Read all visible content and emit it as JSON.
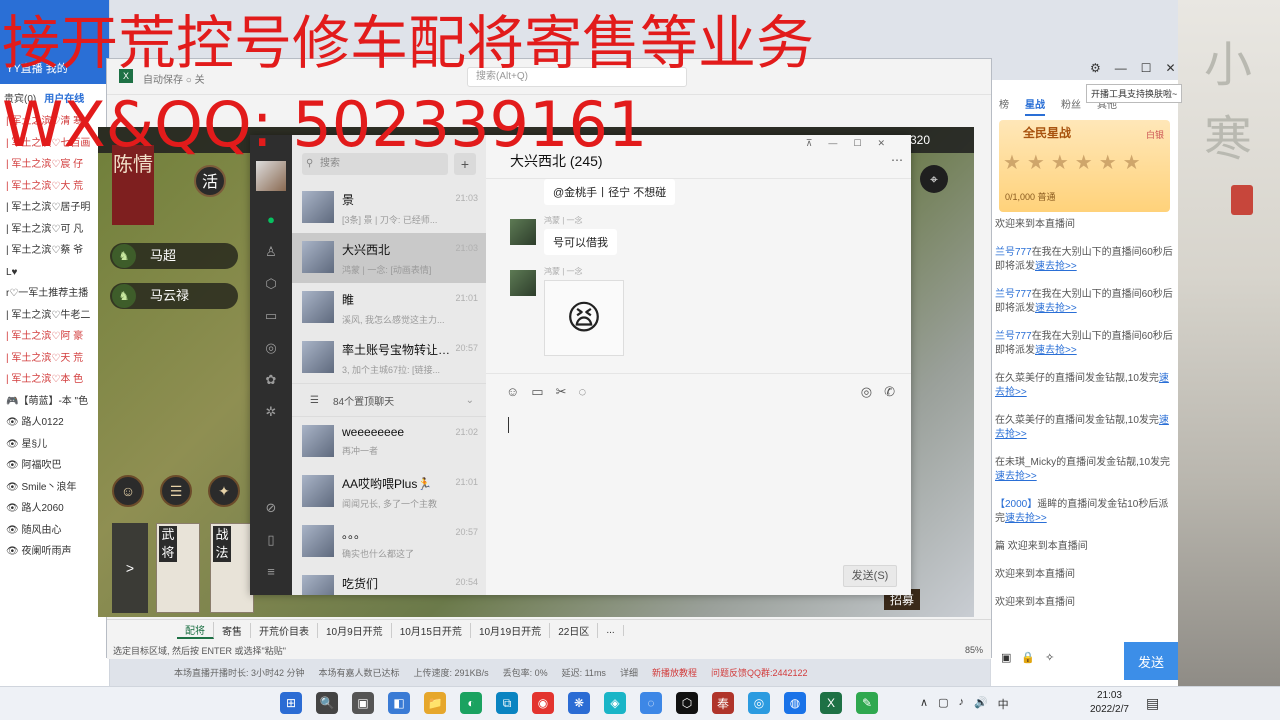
{
  "overlay": {
    "line1": "接开荒控号修车配将寄售等业务",
    "line2": "WX&QQ:   502339161"
  },
  "left_panel": {
    "header_text": "YY直播  我的",
    "tabs": [
      "贵宾(0)",
      "用户在线"
    ],
    "items": [
      {
        "text": "| 军土之滨♡清  寒",
        "red": true
      },
      {
        "text": "| 军土之滨♡七百画",
        "red": true
      },
      {
        "text": "| 军土之滨♡宸  仔",
        "red": true
      },
      {
        "text": "| 军土之滨♡大  荒",
        "red": true
      },
      {
        "text": "| 军土之滨♡居子明",
        "red": false
      },
      {
        "text": "| 军土之滨♡可  凡",
        "red": false
      },
      {
        "text": "| 军土之滨♡蔡  爷",
        "red": false
      },
      {
        "text": "L♥",
        "red": false
      },
      {
        "text": "r♡一军土推荐主播",
        "red": false
      },
      {
        "text": "| 军土之滨♡牛老二",
        "red": false
      },
      {
        "text": "| 军土之滨♡阿  豪",
        "red": true
      },
      {
        "text": "| 军土之滨♡天  荒",
        "red": true
      },
      {
        "text": "| 军土之滨♡本  色",
        "red": true
      },
      {
        "text": "🎮【萌蓝】-本 \"色",
        "red": false
      },
      {
        "text": "👁 路人0122",
        "red": false
      },
      {
        "text": "👁 星§儿",
        "red": false
      },
      {
        "text": "👁 阿福吹巴",
        "red": false
      },
      {
        "text": "👁 Smile丶浪年",
        "red": false
      },
      {
        "text": "👁 路人2060",
        "red": false
      },
      {
        "text": "👁 随风由心",
        "red": false
      },
      {
        "text": "👁 夜阑听雨声",
        "red": false
      }
    ]
  },
  "right_panel": {
    "tabs": [
      "榜",
      "星战",
      "粉丝",
      "其他"
    ],
    "star_title": "全民星战",
    "star_right": "白银",
    "stars": "★★★★★★",
    "star_count": "0/1,000  普通",
    "messages": [
      {
        "pre": "",
        "hl": "",
        "text": "欢迎来到本直播间",
        "link": ""
      },
      {
        "pre": "",
        "hl": "兰号777",
        "text": "在我在大别山下的直播间60秒后即将派发",
        "link": "速去抢>>"
      },
      {
        "pre": "",
        "hl": "兰号777",
        "text": "在我在大别山下的直播间60秒后即将派发",
        "link": "速去抢>>"
      },
      {
        "pre": "",
        "hl": "兰号777",
        "text": "在我在大别山下的直播间60秒后即将派发",
        "link": "速去抢>>"
      },
      {
        "pre": "",
        "hl": "",
        "text": "在久菜美仔的直播间发金钻靓,10发完",
        "link": "速去抢>>"
      },
      {
        "pre": "",
        "hl": "",
        "text": "在久菜美仔的直播间发金钻靓,10发完",
        "link": "速去抢>>"
      },
      {
        "pre": "",
        "hl": "",
        "text": "在未琪_Micky的直播间发金钻靓,10发完",
        "link": "速去抢>>"
      },
      {
        "pre": "",
        "hl": "【2000】",
        "text": "遥眸的直播间发金钻10秒后派完",
        "link": "速去抢>>"
      },
      {
        "pre": "",
        "hl": "",
        "text": "篇  欢迎来到本直播间",
        "link": ""
      },
      {
        "pre": "",
        "hl": "",
        "text": "欢迎来到本直播间",
        "link": ""
      },
      {
        "pre": "",
        "hl": "",
        "text": "欢迎来到本直播间",
        "link": ""
      }
    ],
    "send_label": "发送",
    "tooltip": "开播工具支持换肤啦~"
  },
  "game": {
    "top_number": "320",
    "banner": "陈情",
    "live_badge": "活",
    "heroes": [
      "马超",
      "马云禄"
    ],
    "cards": [
      "武将",
      "战法"
    ],
    "arrow": ">",
    "recruit": "招募",
    "pin": "⌖"
  },
  "excel": {
    "title": "自动保存  ○ 关",
    "search": "搜索(Alt+Q)",
    "sheet_tabs": [
      "配将",
      "寄售",
      "开荒价目表",
      "10月9日开荒",
      "10月15日开荒",
      "10月19日开荒",
      "22日区",
      "..."
    ],
    "active_tab": 0,
    "status_text": "选定目标区域, 然后按 ENTER 或选择\"粘贴\"",
    "zoom": "85%"
  },
  "wechat": {
    "search_placeholder": "搜索",
    "chats": [
      {
        "name": "景",
        "preview": "[3条] 景 | 刀令: 已经师...",
        "time": "21:03"
      },
      {
        "name": "大兴西北",
        "preview": "鸿蒙 | 一念: [动画表情]",
        "time": "21:03"
      },
      {
        "name": "睢",
        "preview": "溪风, 我怎么感觉这主力...",
        "time": "21:01"
      },
      {
        "name": "率土账号宝物转让交...",
        "preview": "3, 加个主城67拉: [链接...",
        "time": "20:57"
      }
    ],
    "pinned": "84个置顶聊天",
    "chats2": [
      {
        "name": "weeeeeeee",
        "preview": "再冲一者",
        "time": "21:02"
      },
      {
        "name": "AA哎哟喂Plus🏃",
        "preview": "闻闻兄长, 多了一个主教",
        "time": "21:01"
      },
      {
        "name": "。。。",
        "preview": "确实也什么都这了",
        "time": "20:57"
      },
      {
        "name": "吃货们",
        "preview": "",
        "time": "20:54"
      }
    ],
    "chat_title": "大兴西北 (245)",
    "top_msg": "@金桃手丨径宁 不想碰",
    "messages": [
      {
        "who": "鸿蒙 | 一念",
        "text": "号可以借我"
      },
      {
        "who": "鸿蒙 | 一念",
        "text": "😫"
      }
    ],
    "send_label": "发送(S)"
  },
  "stream_bar": {
    "items": [
      "本场直播开播时长: 3小时42 分钟",
      "本场有嘉人数已达标",
      "上传速度: 291KB/s",
      "丢包率: 0%",
      "延迟: 11ms",
      "详细"
    ],
    "right": [
      "新播放教程",
      "问题反馈QQ群:2442122"
    ]
  },
  "taskbar": {
    "icons": [
      "⊞",
      "🔍",
      "▣",
      "◧",
      "📁",
      "◐",
      "⧉",
      "◉",
      "❋",
      "◈",
      "◌",
      "⬡",
      "奉",
      "◎",
      "◍",
      "X",
      "✎"
    ],
    "tray": [
      "∧",
      "▢",
      "♪",
      "🔊",
      "中"
    ],
    "time": "21:03",
    "date": "2022/2/7"
  },
  "art": {
    "text": "小寒"
  },
  "colors": {
    "accent": "#2a6fd6",
    "overlay": "#e21b1b",
    "wechat_green": "#07c160",
    "excel_green": "#1e7145"
  }
}
